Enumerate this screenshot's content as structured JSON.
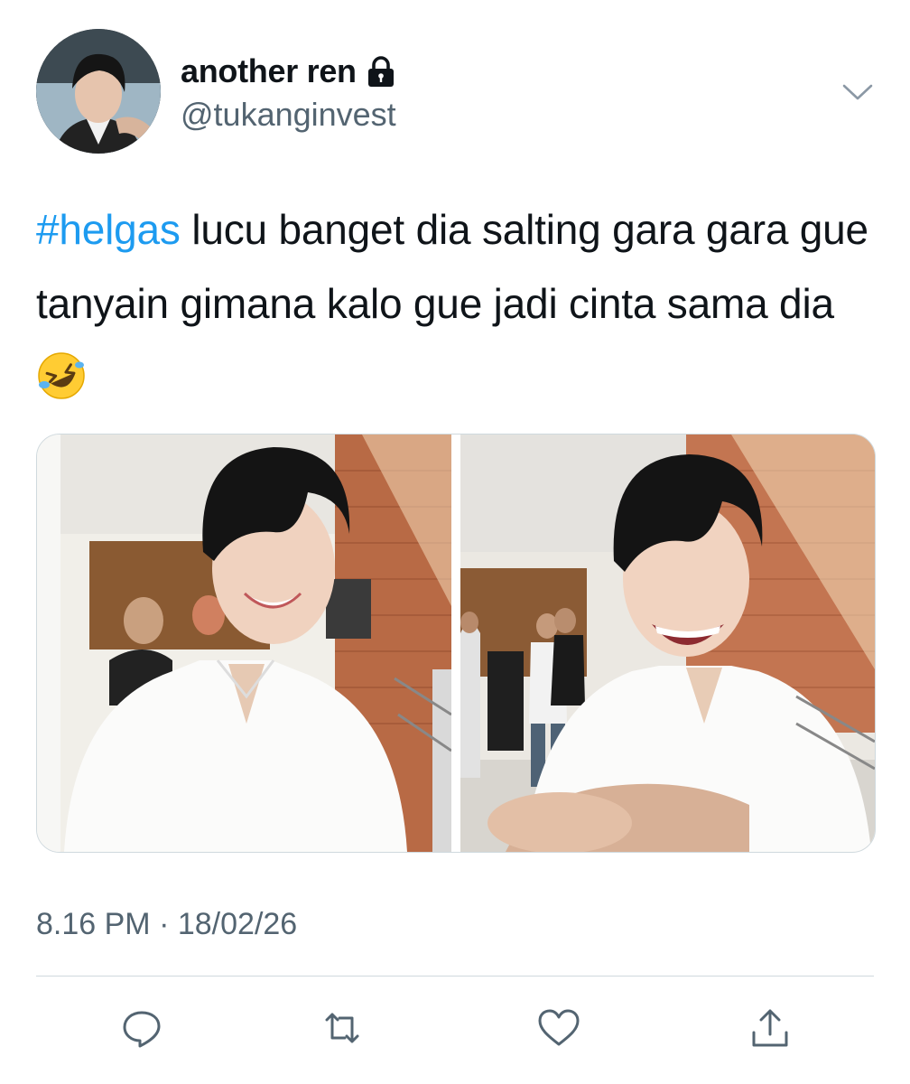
{
  "tweet": {
    "author": {
      "display_name": "another ren",
      "handle": "@tukanginvest",
      "protected_icon": "lock-icon",
      "avatar": "profile-photo"
    },
    "text": {
      "hashtag": "#helgas",
      "body": " lucu banget dia salting gara gara gue tanyain gimana kalo gue jadi cinta sama dia",
      "emoji": "rolling-on-the-floor-laughing"
    },
    "media": [
      {
        "id": "photo-1",
        "description_icon": "photo"
      },
      {
        "id": "photo-2",
        "description_icon": "photo"
      }
    ],
    "timestamp": "8.16 PM",
    "separator": "·",
    "date": "18/02/26"
  },
  "actions": [
    "reply-icon",
    "retweet-icon",
    "like-icon",
    "share-icon"
  ],
  "colors": {
    "accent": "#1d9bf0",
    "text": "#0f1419",
    "secondary": "#536471",
    "border": "#cfd9de"
  }
}
